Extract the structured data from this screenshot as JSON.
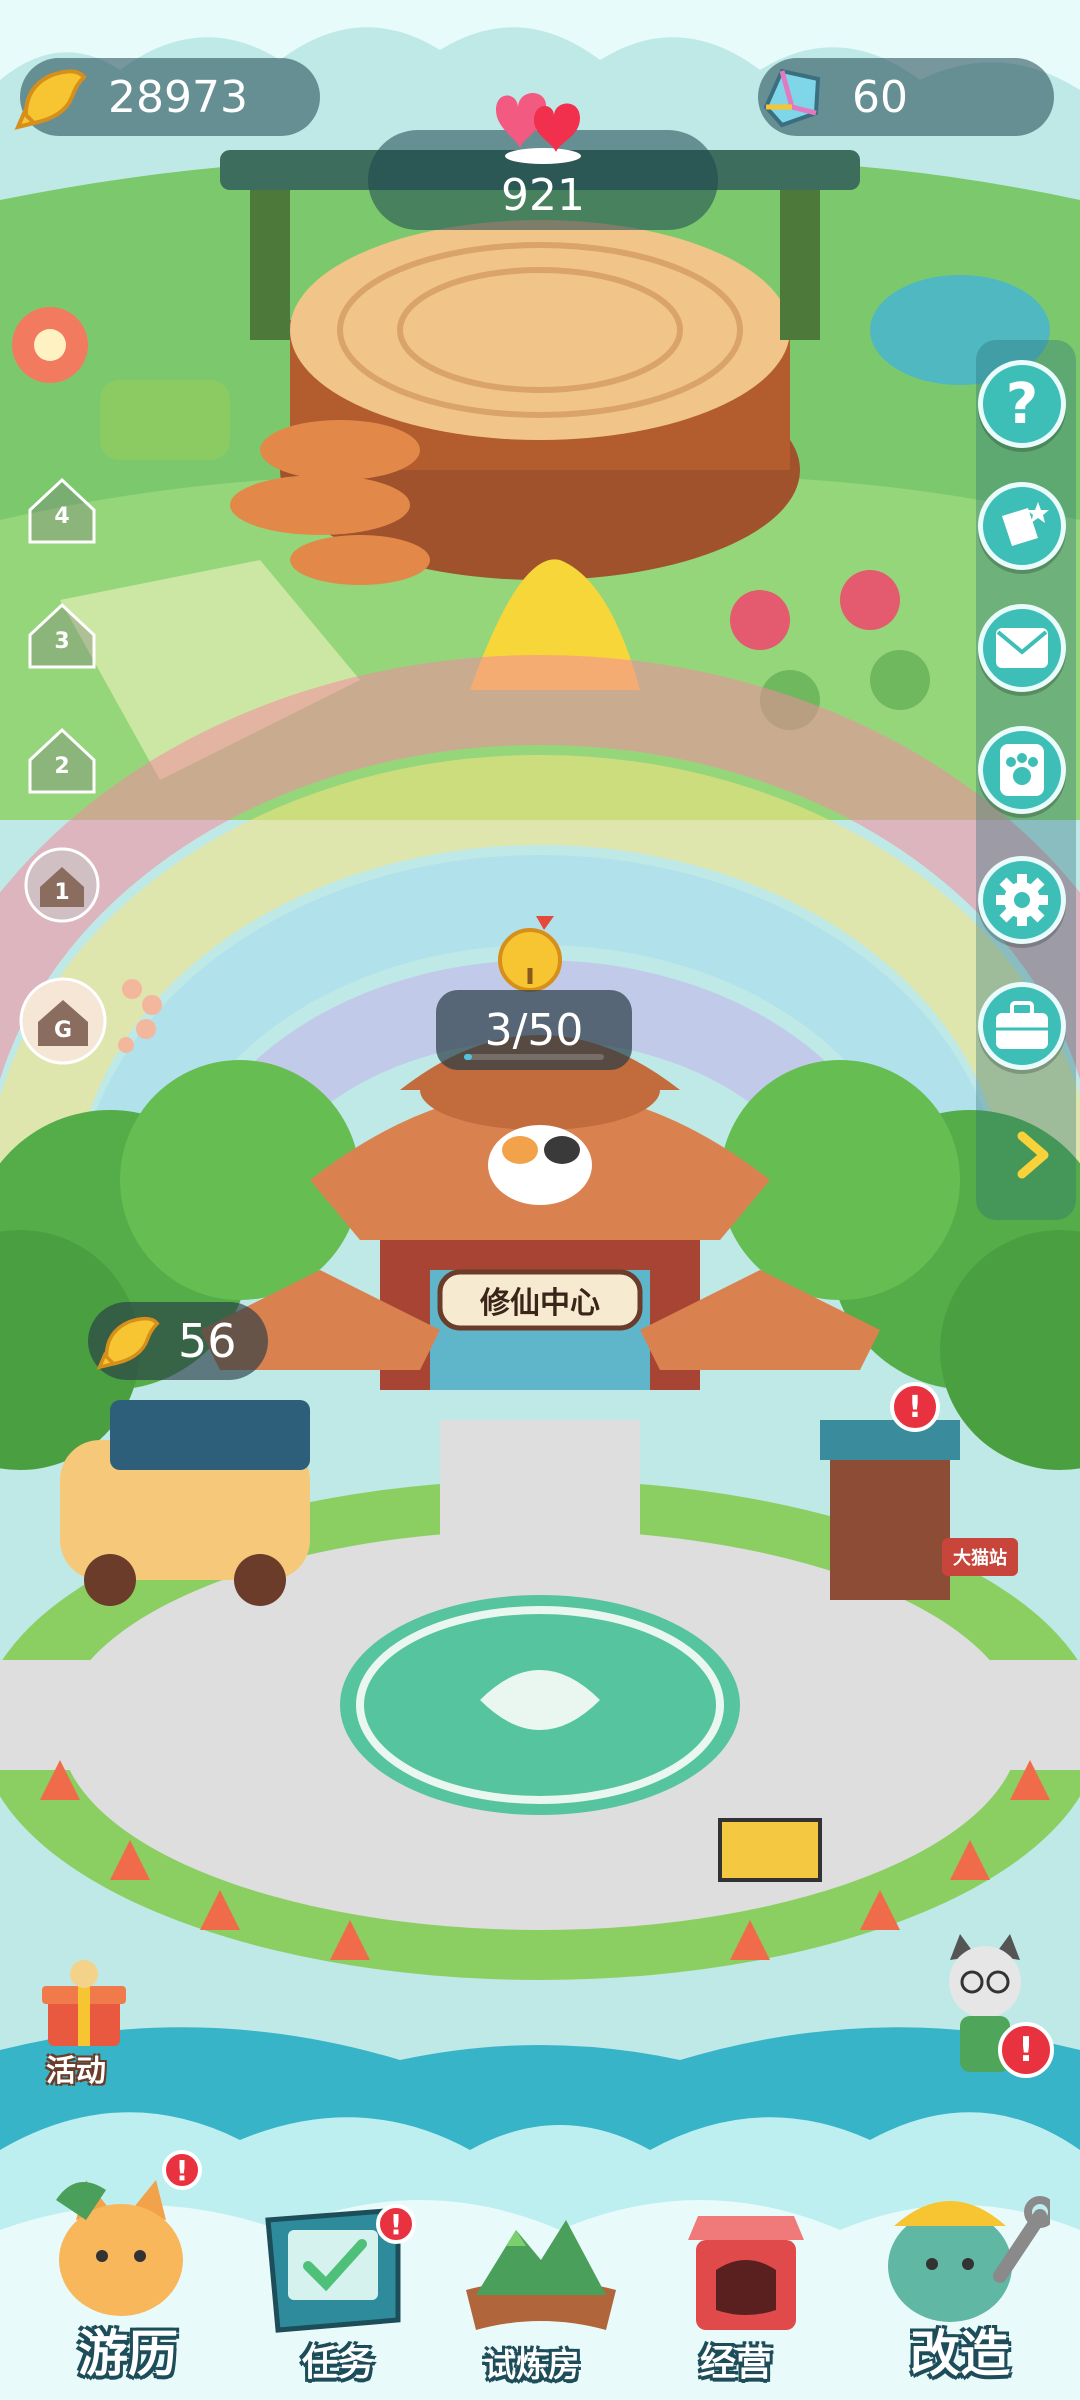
{
  "currency": {
    "coins": "28973",
    "gems": "60",
    "hearts": "921"
  },
  "floors": [
    "4",
    "3",
    "2",
    "1",
    "G"
  ],
  "gate": {
    "progress_text": "3/50",
    "progress": 0.06,
    "sign": "修仙中心"
  },
  "food_truck": {
    "coins": "56"
  },
  "bus_stop_sign": "大猫站",
  "activity_label": "活动",
  "side_buttons": [
    "help",
    "collection",
    "mail",
    "cats",
    "settings",
    "bag",
    "expand"
  ],
  "nav": {
    "travel": "游历",
    "tasks": "任务",
    "trial": "试炼房",
    "business": "经营",
    "upgrade": "改造"
  },
  "icons": {
    "coin": "fish-coin-icon",
    "gem": "rainbow-gem-icon",
    "heart": "hearts-icon"
  },
  "colors": {
    "accent": "#3dbfb7",
    "alert": "#e8323f",
    "coin": "#f7c531"
  }
}
